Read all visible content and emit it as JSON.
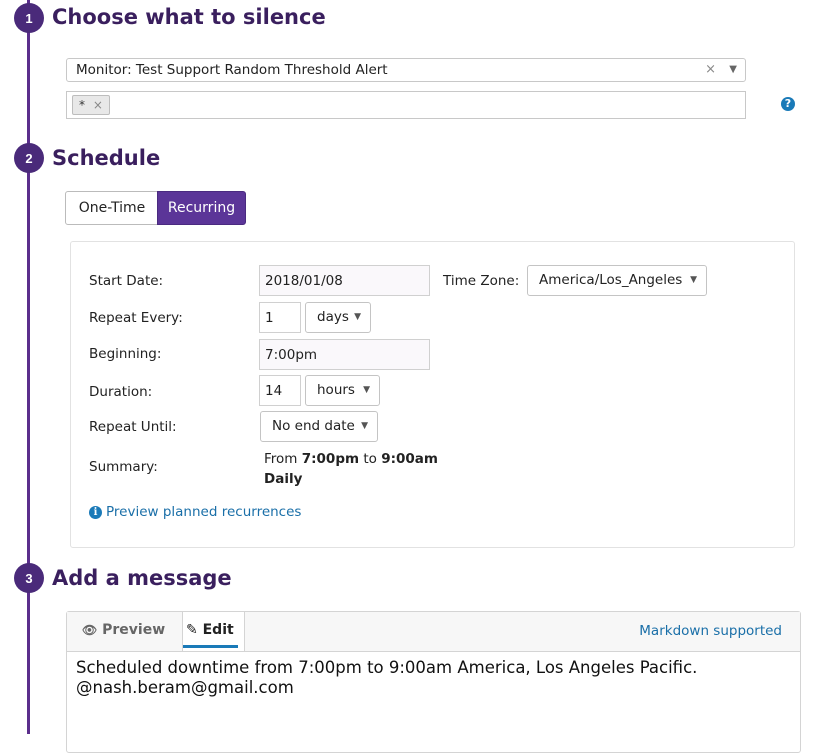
{
  "steps": [
    {
      "number": "1",
      "title": "Choose what to silence"
    },
    {
      "number": "2",
      "title": "Schedule"
    },
    {
      "number": "3",
      "title": "Add a message"
    }
  ],
  "silence": {
    "monitor_value": "Monitor: Test Support Random Threshold Alert",
    "clear_icon": "×",
    "dropdown_icon": "▼",
    "scope_tag": "*",
    "tag_remove_icon": "×",
    "help_icon": "?"
  },
  "schedule": {
    "tabs": [
      "One-Time",
      "Recurring"
    ],
    "active_tab": "Recurring",
    "start_date_label": "Start Date:",
    "start_date_value": "2018/01/08",
    "time_zone_label": "Time Zone:",
    "time_zone_value": "America/Los_Angeles",
    "repeat_every_label": "Repeat Every:",
    "repeat_every_value": "1",
    "repeat_every_unit": "days",
    "beginning_label": "Beginning:",
    "beginning_value": "7:00pm",
    "duration_label": "Duration:",
    "duration_value": "14",
    "duration_unit": "hours",
    "repeat_until_label": "Repeat Until:",
    "repeat_until_value": "No end date",
    "summary_label": "Summary:",
    "summary_from": "From",
    "summary_start": "7:00pm",
    "summary_to": "to",
    "summary_end": "9:00am",
    "summary_freq": "Daily",
    "preview_link": "Preview planned recurrences",
    "info_icon": "i",
    "caret_icon": "▼"
  },
  "message": {
    "tab_preview": "Preview",
    "tab_edit": "Edit",
    "eye_icon": "👁",
    "pencil_icon": "✎",
    "markdown_link": "Markdown supported",
    "text": "Scheduled downtime from 7:00pm to 9:00am America, Los Angeles Pacific.\n@nash.beram@gmail.com"
  },
  "colors": {
    "accent_purple": "#5b3598",
    "timeline": "#5b2e8c",
    "link_blue": "#1a6fa8"
  }
}
